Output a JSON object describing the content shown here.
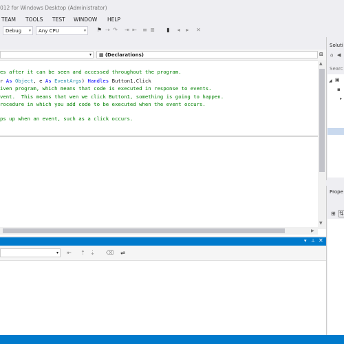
{
  "title": "012 for Windows Desktop (Administrator)",
  "menu": [
    "TEAM",
    "TOOLS",
    "TEST",
    "WINDOW",
    "HELP"
  ],
  "toolbar": {
    "config": "Debug",
    "platform": "Any CPU"
  },
  "editor": {
    "nav_right": "(Declarations)",
    "lines": [
      [
        {
          "t": "es after it can be seen and accessed throughout the program.",
          "c": "cm"
        }
      ],
      [
        {
          "t": "r ",
          "c": "pl"
        },
        {
          "t": "As ",
          "c": "kw"
        },
        {
          "t": "Object",
          "c": "ty"
        },
        {
          "t": ", e ",
          "c": "pl"
        },
        {
          "t": "As ",
          "c": "kw"
        },
        {
          "t": "EventArgs",
          "c": "ty"
        },
        {
          "t": ") ",
          "c": "pl"
        },
        {
          "t": "Handles ",
          "c": "kw"
        },
        {
          "t": "Button1.Click",
          "c": "pl"
        }
      ],
      [
        {
          "t": "iven program, which means that code is executed in response to events.",
          "c": "cm"
        }
      ],
      [
        {
          "t": "vent.  This means that wen we click Button1, something is going to happen.",
          "c": "cm"
        }
      ],
      [
        {
          "t": "rocedure in which you add code to be executed when the event occurs.",
          "c": "cm"
        }
      ],
      [
        {
          "t": "",
          "c": "pl"
        }
      ],
      [
        {
          "t": "ps up when an event, such as a click occurs.",
          "c": "cm"
        }
      ]
    ]
  },
  "solution_title": "Soluti",
  "search_label": "Searc",
  "properties_title": "Prope",
  "colors": {
    "accent": "#007acc",
    "comment": "#008000",
    "keyword": "#0000ff",
    "type": "#2b91af"
  }
}
